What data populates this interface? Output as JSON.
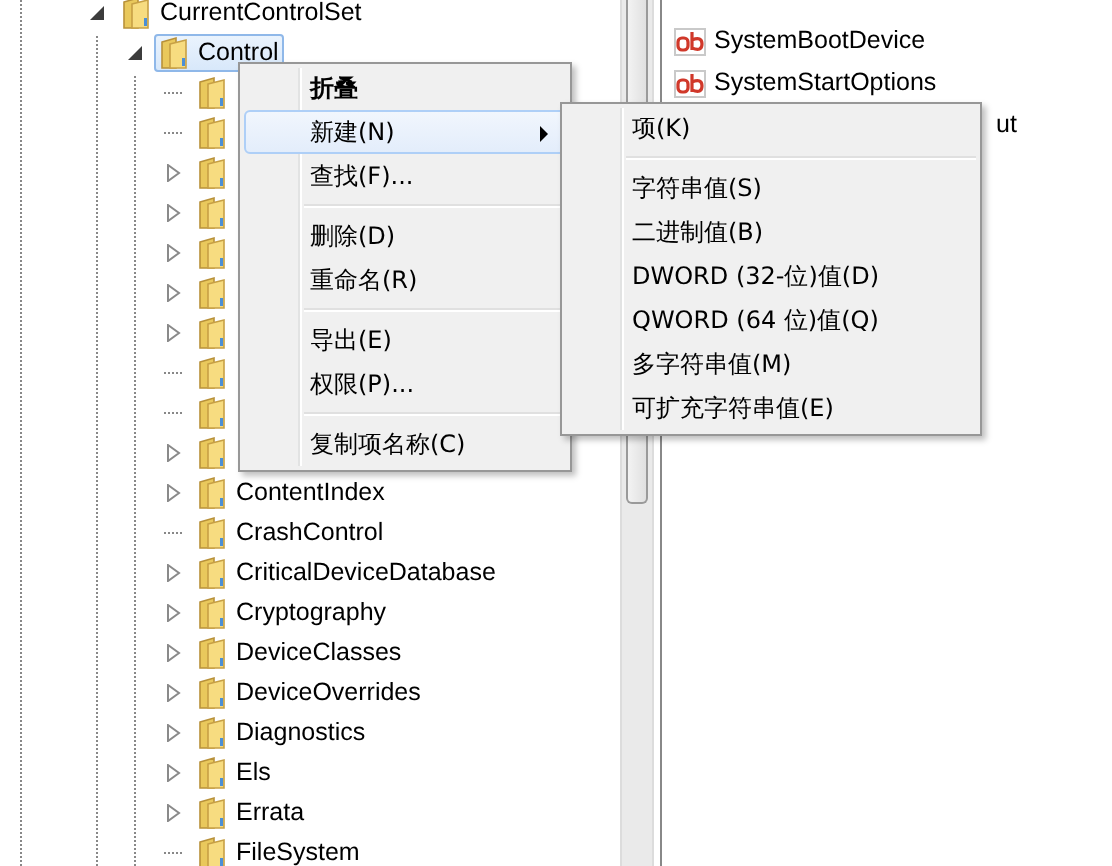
{
  "tree": [
    {
      "label": "CurrentControlSet",
      "expandable": true,
      "expanded": true,
      "selected": false,
      "children": [
        {
          "label": "Control",
          "expandable": true,
          "expanded": true,
          "selected": true,
          "children": [
            {
              "expandable": false
            },
            {
              "expandable": false
            },
            {
              "expandable": true
            },
            {
              "expandable": true
            },
            {
              "expandable": true
            },
            {
              "expandable": true
            },
            {
              "expandable": true
            },
            {
              "expandable": false
            },
            {
              "expandable": false
            },
            {
              "expandable": true
            },
            {
              "label": "ContentIndex",
              "expandable": true
            },
            {
              "label": "CrashControl",
              "expandable": false
            },
            {
              "label": "CriticalDeviceDatabase",
              "expandable": true
            },
            {
              "label": "Cryptography",
              "expandable": true
            },
            {
              "label": "DeviceClasses",
              "expandable": true
            },
            {
              "label": "DeviceOverrides",
              "expandable": true
            },
            {
              "label": "Diagnostics",
              "expandable": true
            },
            {
              "label": "Els",
              "expandable": true
            },
            {
              "label": "Errata",
              "expandable": true
            },
            {
              "label": "FileSystem",
              "expandable": false
            }
          ]
        }
      ]
    }
  ],
  "values": [
    {
      "name": "SystemBootDevice",
      "kind": "string"
    },
    {
      "name": "SystemStartOptions",
      "kind": "string"
    },
    {
      "name": "ut",
      "kind": "covered"
    }
  ],
  "context_menu": [
    {
      "kind": "item",
      "label": "折叠",
      "default": true,
      "selected": false
    },
    {
      "kind": "item",
      "label": "新建(N)",
      "selected": true,
      "submenu": true
    },
    {
      "kind": "item",
      "label": "查找(F)...",
      "selected": false
    },
    {
      "kind": "separator"
    },
    {
      "kind": "item",
      "label": "删除(D)",
      "selected": false
    },
    {
      "kind": "item",
      "label": "重命名(R)",
      "selected": false
    },
    {
      "kind": "separator"
    },
    {
      "kind": "item",
      "label": "导出(E)",
      "selected": false
    },
    {
      "kind": "item",
      "label": "权限(P)...",
      "selected": false
    },
    {
      "kind": "separator"
    },
    {
      "kind": "item",
      "label": "复制项名称(C)",
      "selected": false
    }
  ],
  "submenu": [
    {
      "kind": "item",
      "label": "项(K)",
      "selected": false
    },
    {
      "kind": "separator"
    },
    {
      "kind": "item",
      "label": "字符串值(S)",
      "selected": false
    },
    {
      "kind": "item",
      "label": "二进制值(B)",
      "selected": false
    },
    {
      "kind": "item",
      "label": "DWORD (32-位)值(D)",
      "selected": false
    },
    {
      "kind": "item",
      "label": "QWORD (64 位)值(Q)",
      "selected": false
    },
    {
      "kind": "item",
      "label": "多字符串值(M)",
      "selected": false
    },
    {
      "kind": "item",
      "label": "可扩充字符串值(E)",
      "selected": false
    }
  ]
}
